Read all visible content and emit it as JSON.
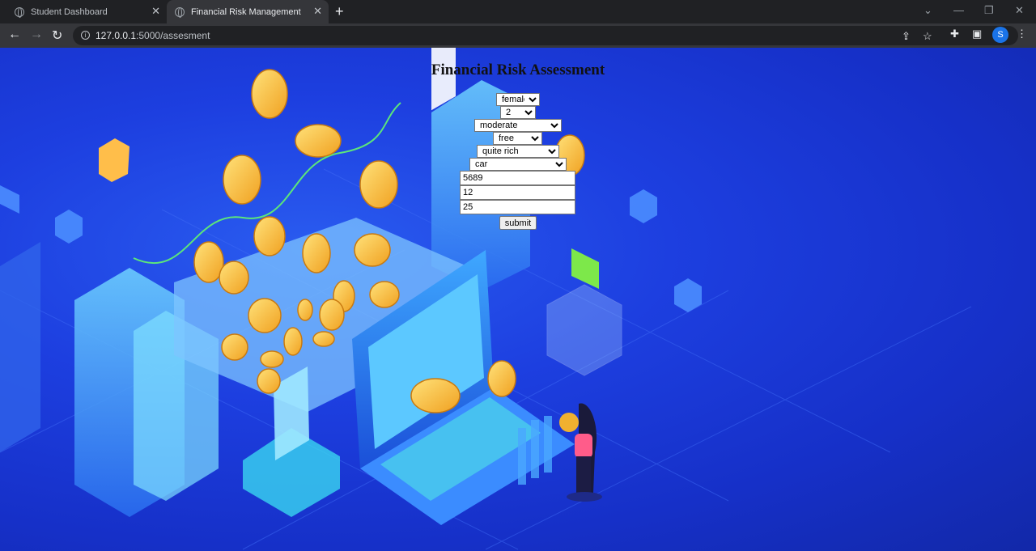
{
  "browser": {
    "tabs": [
      {
        "title": "Student Dashboard",
        "active": false
      },
      {
        "title": "Financial Risk Management",
        "active": true
      }
    ],
    "url_host": "127.0.0.1",
    "url_rest": ":5000/assesment",
    "profile_initial": "S"
  },
  "page": {
    "title": "Financial Risk Assessment",
    "fields": {
      "sex": "female",
      "job": "2",
      "housing_or_rate": "moderate",
      "housing": "free",
      "saving_accounts": "quite rich",
      "purpose": "car",
      "credit_amount": "5689",
      "duration": "12",
      "age": "25"
    },
    "submit_label": "submit"
  },
  "colors": {
    "background": "#1d3fe0",
    "chrome_dark": "#202124",
    "chrome_toolbar": "#35363a"
  }
}
